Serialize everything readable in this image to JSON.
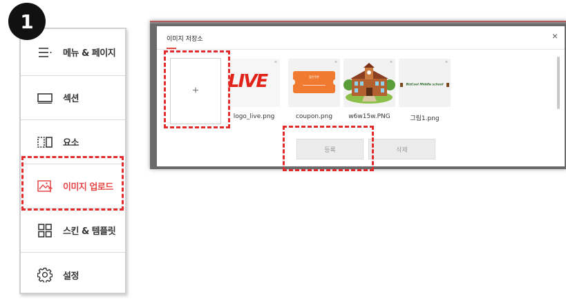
{
  "step_badge": "1",
  "side_menu": {
    "items": [
      {
        "label": "메뉴 & 페이지",
        "icon": "menu-lines-icon"
      },
      {
        "label": "섹션",
        "icon": "section-icon"
      },
      {
        "label": "요소",
        "icon": "element-icon"
      },
      {
        "label": "이미지 업로드",
        "icon": "image-upload-icon",
        "active": true
      },
      {
        "label": "스킨 & 템플릿",
        "icon": "grid-icon"
      },
      {
        "label": "설정",
        "icon": "gear-icon"
      }
    ]
  },
  "dialog": {
    "title": "이미지 저장소",
    "close": "×",
    "upload_tile": "+",
    "images": [
      {
        "name": "logo_live.png",
        "preview_text": "LIVE",
        "remove": "×"
      },
      {
        "name": "coupon.png",
        "preview_text": "할인쿠폰",
        "remove": "×"
      },
      {
        "name": "w6w15w.PNG",
        "remove": "×"
      },
      {
        "name": "그림1.png",
        "preview_text": "BizCool Middle school",
        "remove": "×"
      }
    ],
    "buttons": {
      "register": "등록",
      "delete": "삭제"
    }
  },
  "colors": {
    "accent_red": "#e32b2b",
    "active_label": "#e64545",
    "coupon_orange": "#f07b30"
  }
}
